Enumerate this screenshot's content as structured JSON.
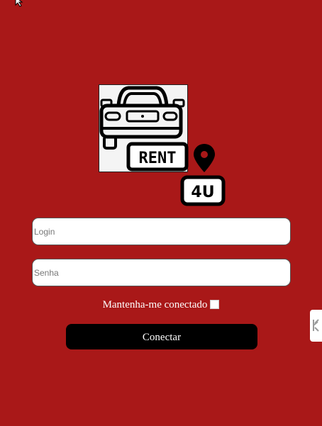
{
  "logo": {
    "badge_text": "RENT",
    "tag_text": "4U"
  },
  "form": {
    "login_placeholder": "Login",
    "senha_placeholder": "Senha",
    "remember_label": "Mantenha-me conectado",
    "remember_checked": false,
    "submit_label": "Conectar"
  },
  "colors": {
    "background": "#a91818",
    "button": "#000000"
  },
  "icons": [
    "cursor-arrow-icon",
    "car-icon",
    "location-pin-icon",
    "side-widget-icon"
  ]
}
